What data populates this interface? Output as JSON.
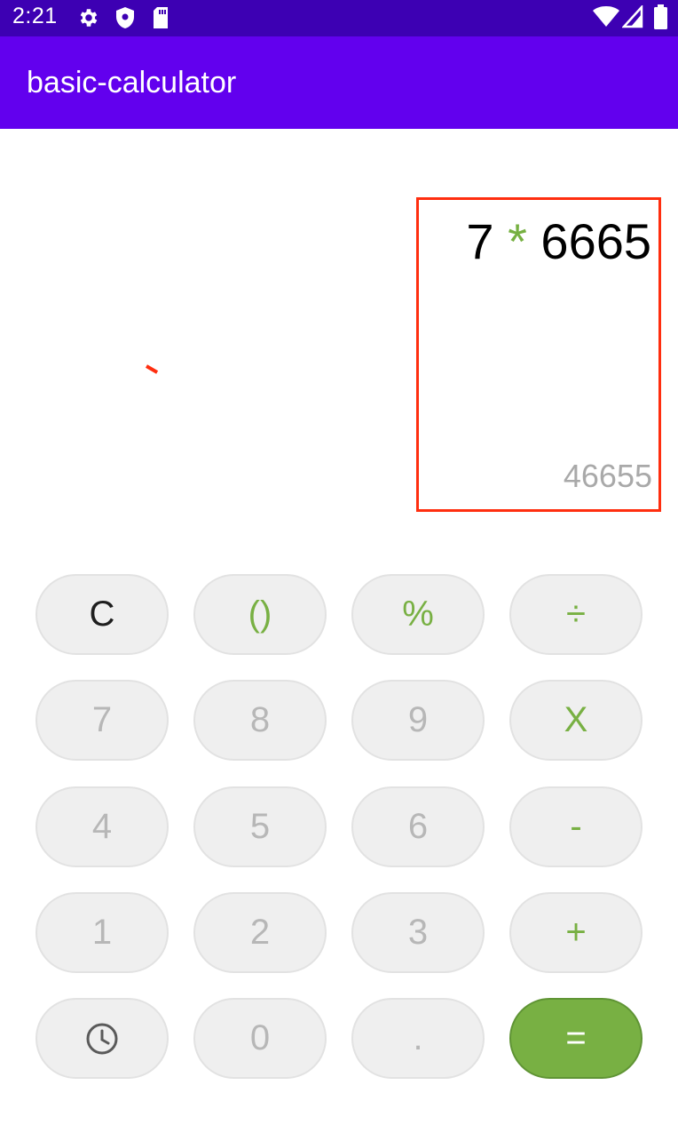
{
  "status_bar": {
    "time": "2:21",
    "icons": [
      "settings-icon",
      "shield-icon",
      "sd-card-icon",
      "wifi-icon",
      "cell-signal-icon",
      "battery-icon"
    ]
  },
  "app_bar": {
    "title": "basic-calculator",
    "color": "#6200ee"
  },
  "display": {
    "expression_left": "7",
    "expression_op": "*",
    "expression_right": "6665",
    "result": "46655"
  },
  "keypad": {
    "rows": [
      [
        "C",
        "()",
        "%",
        "÷"
      ],
      [
        "7",
        "8",
        "9",
        "X"
      ],
      [
        "4",
        "5",
        "6",
        "-"
      ],
      [
        "1",
        "2",
        "3",
        "+"
      ],
      [
        "history-icon",
        "0",
        ".",
        "="
      ]
    ],
    "accent_color": "#78b043"
  }
}
